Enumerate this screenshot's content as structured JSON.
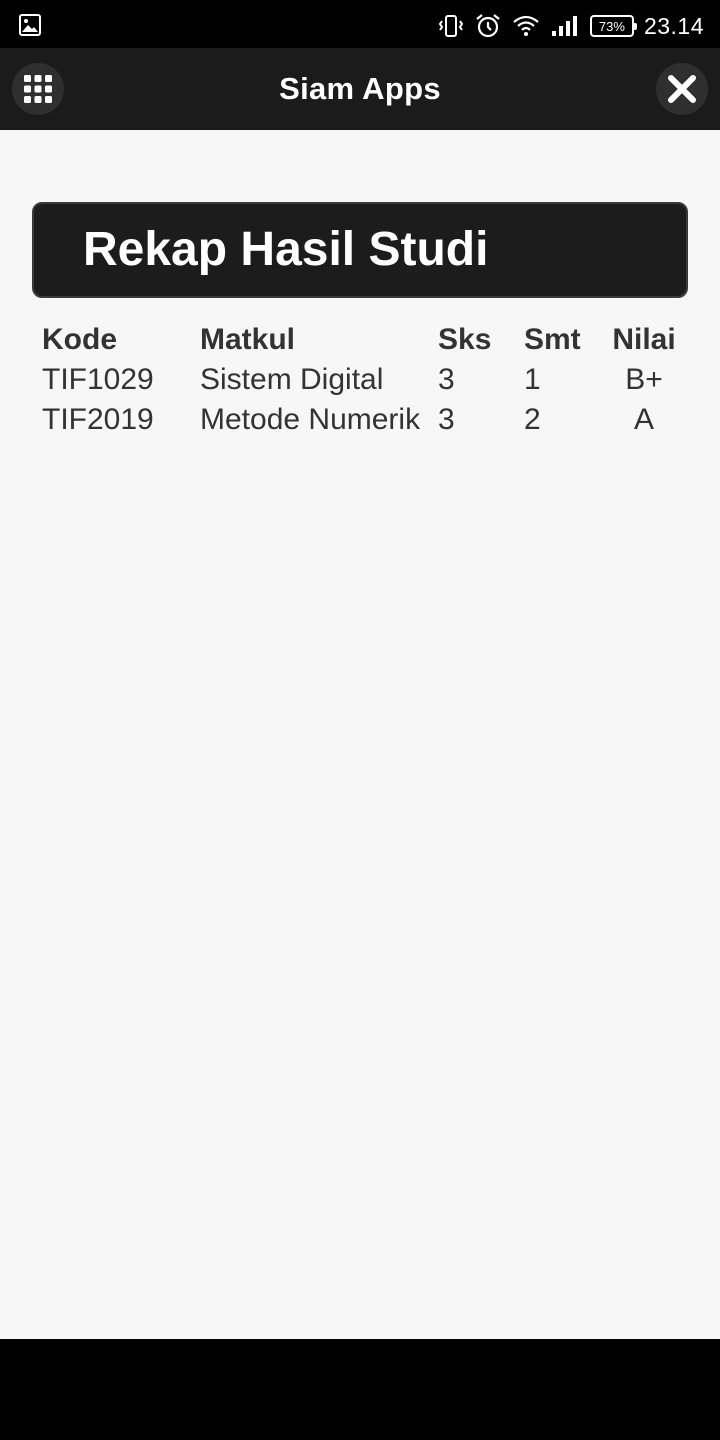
{
  "status_bar": {
    "battery_percent": "73%",
    "time": "23.14"
  },
  "app_bar": {
    "title": "Siam Apps",
    "menu_icon": "grid-icon",
    "close_icon": "close-icon"
  },
  "page": {
    "title": "Rekap Hasil Studi"
  },
  "table": {
    "headers": {
      "kode": "Kode",
      "matkul": "Matkul",
      "sks": "Sks",
      "smt": "Smt",
      "nilai": "Nilai"
    },
    "rows": [
      {
        "kode": "TIF1029",
        "matkul": "Sistem Digital",
        "sks": "3",
        "smt": "1",
        "nilai": "B+"
      },
      {
        "kode": "TIF2019",
        "matkul": "Metode Numerik",
        "sks": "3",
        "smt": "2",
        "nilai": "A"
      }
    ]
  }
}
